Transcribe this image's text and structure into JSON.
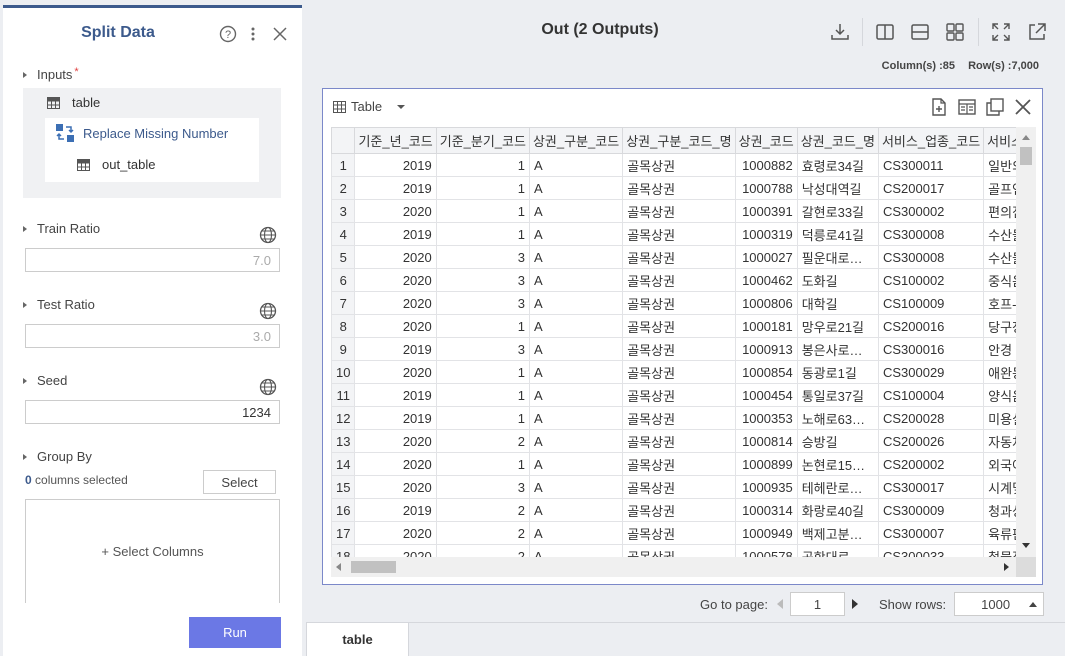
{
  "left_panel": {
    "title": "Split Data",
    "inputs": {
      "label": "Inputs",
      "required_mark": "*",
      "items": [
        "table",
        "Replace Missing Number",
        "out_table"
      ]
    },
    "train_ratio": {
      "label": "Train Ratio",
      "placeholder": "7.0"
    },
    "test_ratio": {
      "label": "Test Ratio",
      "placeholder": "3.0"
    },
    "seed": {
      "label": "Seed",
      "value": "1234"
    },
    "group_by": {
      "label": "Group By",
      "count": "0",
      "count_text": "columns selected",
      "select_label": "Select",
      "add_columns_label": "+ Select Columns"
    },
    "run_label": "Run"
  },
  "output": {
    "title": "Out (2 Outputs)",
    "columns_text": "Column(s) :85",
    "rows_text": "Row(s) :7,000",
    "view_label": "Table"
  },
  "table": {
    "columns": [
      "기준_년_코드",
      "기준_분기_코드",
      "상권_구분_코드",
      "상권_구분_코드_명",
      "상권_코드",
      "상권_코드_명",
      "서비스_업종_코드",
      "서비스_업종"
    ],
    "rows": [
      [
        "1",
        "2019",
        "1",
        "A",
        "골목상권",
        "1000882",
        "효령로34길",
        "CS300011",
        "일반의"
      ],
      [
        "2",
        "2019",
        "1",
        "A",
        "골목상권",
        "1000788",
        "낙성대역길",
        "CS200017",
        "골프연"
      ],
      [
        "3",
        "2020",
        "1",
        "A",
        "골목상권",
        "1000391",
        "갈현로33길",
        "CS300002",
        "편의점"
      ],
      [
        "4",
        "2019",
        "1",
        "A",
        "골목상권",
        "1000319",
        "덕릉로41길",
        "CS300008",
        "수산물"
      ],
      [
        "5",
        "2020",
        "3",
        "A",
        "골목상권",
        "1000027",
        "필운대로…",
        "CS300008",
        "수산물"
      ],
      [
        "6",
        "2020",
        "3",
        "A",
        "골목상권",
        "1000462",
        "도화길",
        "CS100002",
        "중식음"
      ],
      [
        "7",
        "2020",
        "3",
        "A",
        "골목상권",
        "1000806",
        "대학길",
        "CS100009",
        "호프-간"
      ],
      [
        "8",
        "2020",
        "1",
        "A",
        "골목상권",
        "1000181",
        "망우로21길",
        "CS200016",
        "당구장"
      ],
      [
        "9",
        "2019",
        "3",
        "A",
        "골목상권",
        "1000913",
        "봉은사로…",
        "CS300016",
        "안경"
      ],
      [
        "10",
        "2020",
        "1",
        "A",
        "골목상권",
        "1000854",
        "동광로1길",
        "CS300029",
        "애완동"
      ],
      [
        "11",
        "2019",
        "1",
        "A",
        "골목상권",
        "1000454",
        "통일로37길",
        "CS100004",
        "양식음"
      ],
      [
        "12",
        "2019",
        "1",
        "A",
        "골목상권",
        "1000353",
        "노해로63…",
        "CS200028",
        "미용실"
      ],
      [
        "13",
        "2020",
        "2",
        "A",
        "골목상권",
        "1000814",
        "승방길",
        "CS200026",
        "자동차"
      ],
      [
        "14",
        "2020",
        "1",
        "A",
        "골목상권",
        "1000899",
        "논현로15…",
        "CS200002",
        "외국어"
      ],
      [
        "15",
        "2020",
        "3",
        "A",
        "골목상권",
        "1000935",
        "테헤란로…",
        "CS300017",
        "시계및"
      ],
      [
        "16",
        "2019",
        "2",
        "A",
        "골목상권",
        "1000314",
        "화랑로40길",
        "CS300009",
        "청과상"
      ],
      [
        "17",
        "2020",
        "2",
        "A",
        "골목상권",
        "1000949",
        "백제고분…",
        "CS300007",
        "육류판"
      ],
      [
        "18",
        "2020",
        "2",
        "A",
        "골목상권",
        "1000578",
        "공항대로…",
        "CS300033",
        "철물점"
      ]
    ]
  },
  "pager": {
    "goto_label": "Go to page:",
    "page": "1",
    "show_rows_label": "Show rows:",
    "rows_value": "1000"
  },
  "bottom_tabs": [
    "table"
  ],
  "colors": {
    "accent": "#3c5a8c",
    "run_button": "#6b78e5",
    "panel_border": "#7b88c9"
  }
}
